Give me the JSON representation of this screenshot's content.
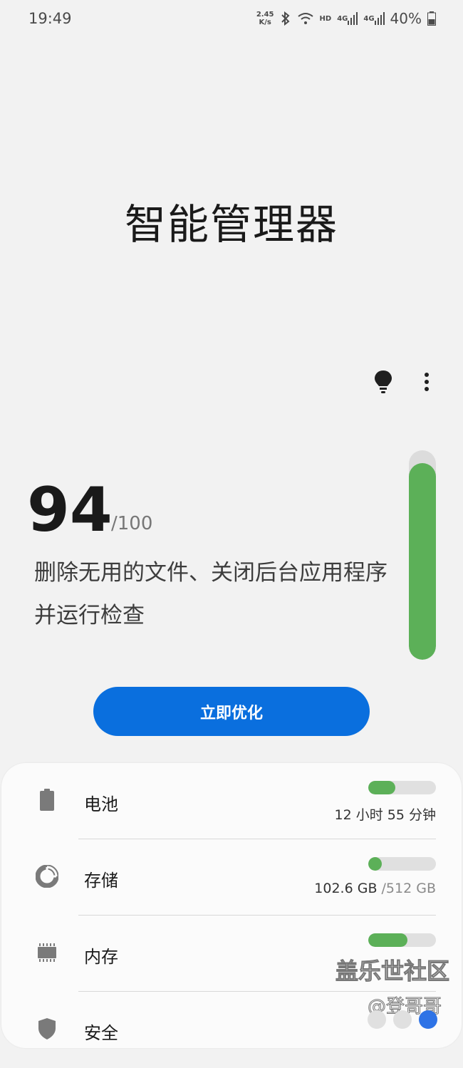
{
  "status_bar": {
    "time": "19:49",
    "net_speed_value": "2.45",
    "net_speed_unit": "K/s",
    "hd_label": "HD",
    "signal1_label": "4G",
    "signal2_label": "4G",
    "battery_percent": "40%"
  },
  "header": {
    "title": "智能管理器"
  },
  "score": {
    "value": "94",
    "max": "/100",
    "fill_fraction": 0.94,
    "description": "删除无用的文件、关闭后台应用程序并运行检查"
  },
  "optimize_button": {
    "label": "立即优化"
  },
  "items": [
    {
      "label": "电池",
      "value": "12 小时 55 分钟",
      "value_muted": "",
      "fill_fraction": 0.4,
      "icon": "battery-icon"
    },
    {
      "label": "存储",
      "value": "102.6 GB ",
      "value_muted": "/512 GB",
      "fill_fraction": 0.2,
      "icon": "storage-pie-icon"
    },
    {
      "label": "内存",
      "value": "",
      "value_muted": "",
      "fill_fraction": 0.58,
      "icon": "memory-chip-icon"
    },
    {
      "label": "安全",
      "value": "",
      "value_muted": "",
      "fill_fraction": 0,
      "icon": "shield-icon"
    }
  ],
  "watermark": {
    "line1": "盖乐世社区",
    "line2": "@登哥哥"
  },
  "colors": {
    "accent_blue": "#0a6fde",
    "good_green": "#5cb058",
    "background": "#f2f2f2"
  }
}
